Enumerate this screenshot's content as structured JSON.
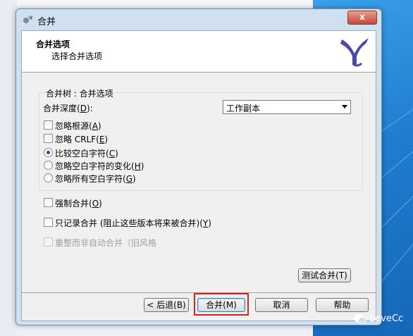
{
  "window": {
    "title": "合并",
    "close_glyph": "x"
  },
  "header": {
    "title": "合并选项",
    "subtitle": "选择合并选项"
  },
  "group": {
    "label": "合并树 : 合并选项"
  },
  "depth": {
    "label": "合并深度",
    "key": "D",
    "suffix": ":",
    "selected": "工作副本"
  },
  "options": {
    "ignore_ancestry": {
      "label": "忽略根源",
      "key": "A",
      "checked": false
    },
    "ignore_crlf": {
      "label": "忽略 CRLF",
      "key": "E",
      "checked": false
    },
    "compare_whitespace": {
      "label": "比较空白字符",
      "key": "C",
      "selected": true
    },
    "ignore_ws_changes": {
      "label": "忽略空白字符的变化",
      "key": "H",
      "selected": false
    },
    "ignore_all_ws": {
      "label": "忽略所有空白字符",
      "key": "G",
      "selected": false
    },
    "force_merge": {
      "label": "强制合并",
      "key": "O",
      "checked": false
    },
    "record_only": {
      "label": "只记录合并 (阻止这些版本将来被合并)",
      "key": "Y",
      "checked": false
    },
    "reintegrate": {
      "label": "重整而非自动合并（旧风格",
      "checked": false,
      "disabled": true
    }
  },
  "buttons": {
    "test_merge": "测试合并(T)",
    "back": "< 后退(B)",
    "merge": "合并(M)",
    "cancel": "取消",
    "help": "帮助"
  },
  "watermark": {
    "text": "SeveCc"
  },
  "colors": {
    "highlight": "#e02020",
    "radio_dot": "#1b4f8f",
    "desktop": "#1f7dd1"
  }
}
